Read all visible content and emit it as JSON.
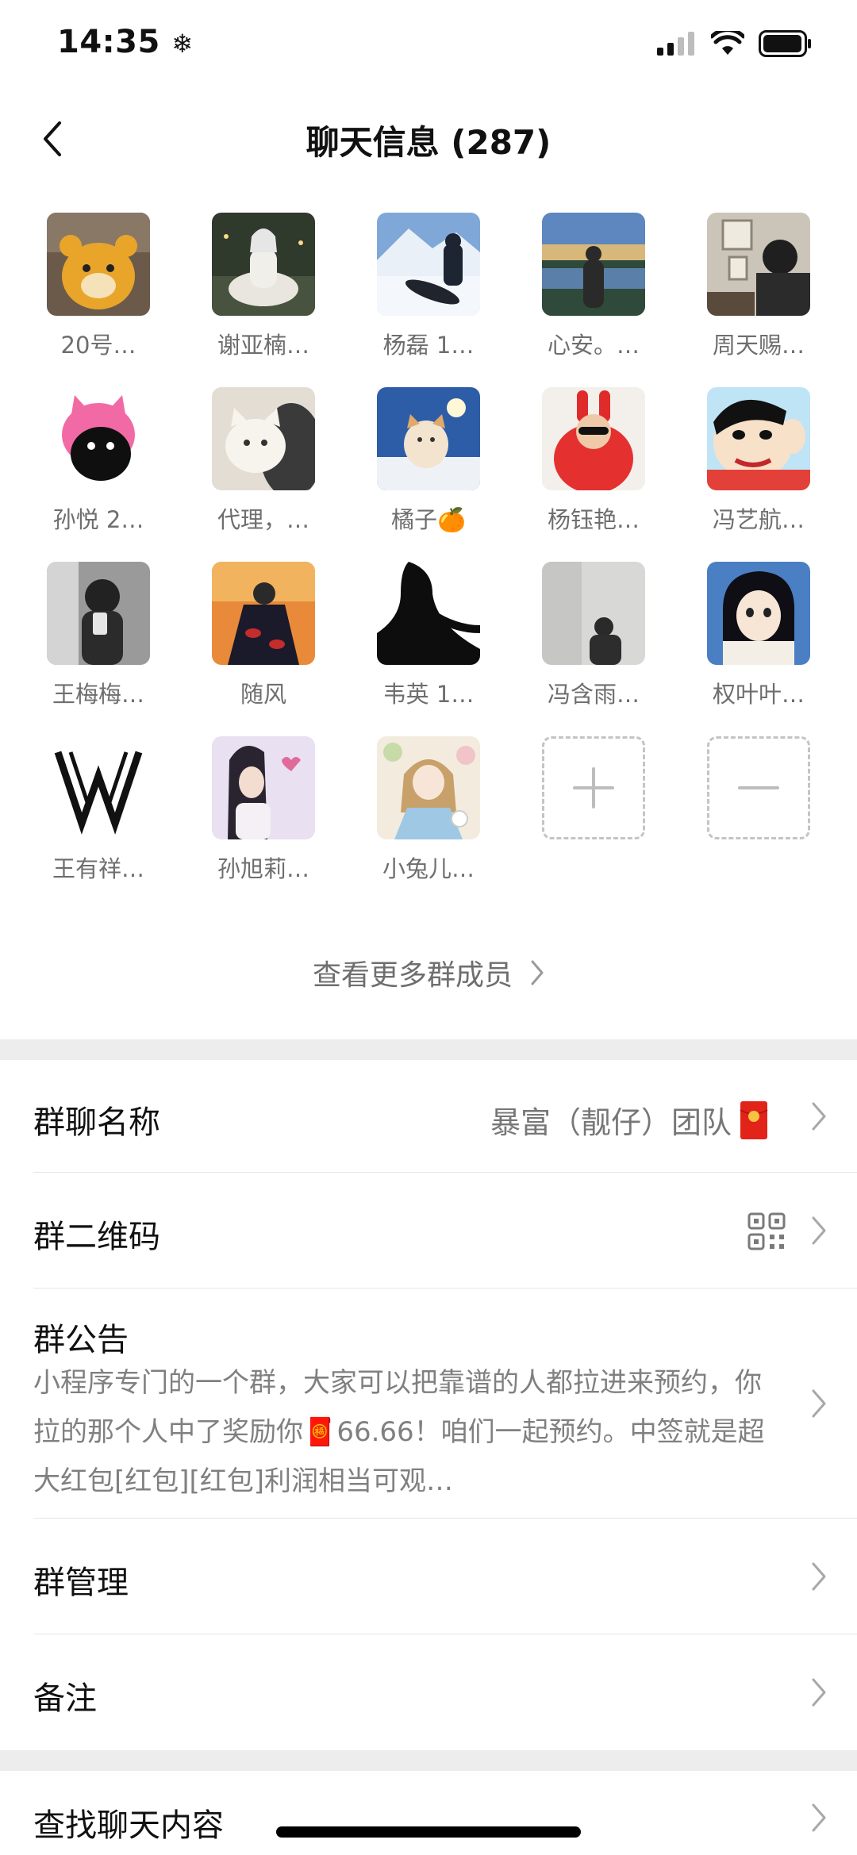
{
  "status": {
    "time": "14:35"
  },
  "nav": {
    "title": "聊天信息 (287)"
  },
  "members": [
    {
      "name": "20号…"
    },
    {
      "name": "谢亚楠…"
    },
    {
      "name": "杨磊 1…"
    },
    {
      "name": "心安。…"
    },
    {
      "name": "周天赐…"
    },
    {
      "name": "孙悦 2…"
    },
    {
      "name": "代理，…"
    },
    {
      "name": "橘子🍊"
    },
    {
      "name": "杨钰艳…"
    },
    {
      "name": "冯艺航…"
    },
    {
      "name": "王梅梅…"
    },
    {
      "name": "随风"
    },
    {
      "name": "韦英 1…"
    },
    {
      "name": "冯含雨…"
    },
    {
      "name": "权叶叶…"
    },
    {
      "name": "王有祥…"
    },
    {
      "name": "孙旭莉…"
    },
    {
      "name": "小兔儿…"
    }
  ],
  "more_members": "查看更多群成员",
  "settings": {
    "group_name_label": "群聊名称",
    "group_name_value": "暴富（靓仔）团队",
    "qr_label": "群二维码",
    "notice_label": "群公告",
    "notice_text": "小程序专门的一个群，大家可以把靠谱的人都拉进来预约，你拉的那个人中了奖励你🧧66.66！咱们一起预约。中签就是超大红包[红包][红包]利润相当可观…",
    "manage_label": "群管理",
    "remark_label": "备注",
    "search_label": "查找聊天内容"
  }
}
